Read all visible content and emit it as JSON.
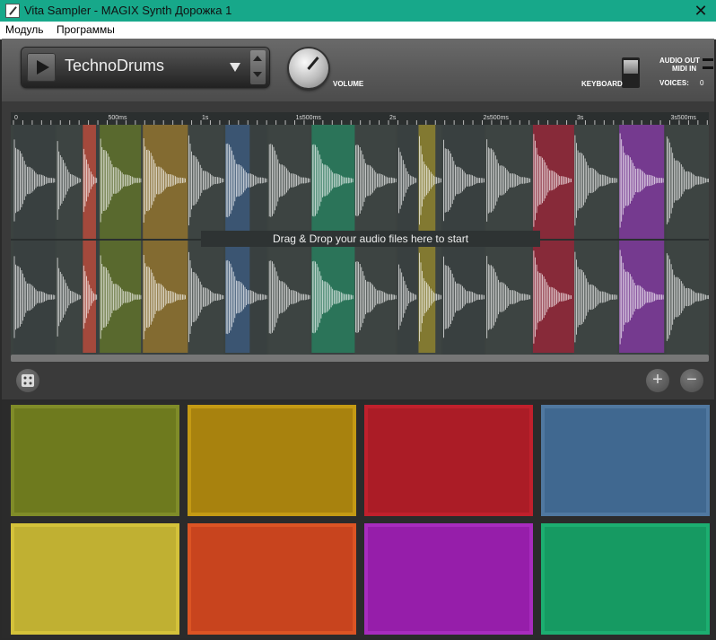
{
  "window": {
    "title": "Vita Sampler - MAGIX Synth Дорожка 1",
    "close_icon": "close-icon"
  },
  "menu": [
    "Модуль",
    "Программы"
  ],
  "instrument": {
    "preset_name": "TechnoDrums",
    "volume_label": "VOLUME",
    "keyboard_label": "KEYBOARD",
    "audio_out_label": "AUDIO OUT",
    "midi_in_label": "MIDI IN",
    "voices_label": "VOICES:",
    "voices_value": "0"
  },
  "timeline": {
    "ruler": [
      {
        "label": "0",
        "time_s": 0
      },
      {
        "label": "500ms",
        "time_s": 0.5
      },
      {
        "label": "1s",
        "time_s": 1.0
      },
      {
        "label": "1s500ms",
        "time_s": 1.5
      },
      {
        "label": "2s",
        "time_s": 2.0
      },
      {
        "label": "2s500ms",
        "time_s": 2.5
      },
      {
        "label": "3s",
        "time_s": 3.0
      },
      {
        "label": "3s500ms",
        "time_s": 3.5
      }
    ],
    "drop_message": "Drag & Drop your audio files here to start",
    "regions": [
      {
        "color": "#b04a3c",
        "start_s": 0.37,
        "end_s": 0.44
      },
      {
        "color": "#5c6e2c",
        "start_s": 0.46,
        "end_s": 0.68
      },
      {
        "color": "#8c7030",
        "start_s": 0.69,
        "end_s": 0.93
      },
      {
        "color": "#3c5878",
        "start_s": 1.13,
        "end_s": 1.26
      },
      {
        "color": "#2a7a5c",
        "start_s": 1.59,
        "end_s": 1.82
      },
      {
        "color": "#8a8030",
        "start_s": 2.16,
        "end_s": 2.25
      },
      {
        "color": "#902838",
        "start_s": 2.77,
        "end_s": 2.99
      },
      {
        "color": "#7c3a98",
        "start_s": 3.23,
        "end_s": 3.47
      }
    ],
    "hits_s": [
      0.0,
      0.23,
      0.37,
      0.46,
      0.69,
      0.93,
      1.13,
      1.36,
      1.59,
      1.82,
      2.05,
      2.16,
      2.29,
      2.52,
      2.77,
      2.99,
      3.23,
      3.48
    ]
  },
  "toolbar": {
    "dice_icon": "dice-icon",
    "zoom_in_icon": "zoom-in-icon",
    "zoom_out_icon": "zoom-out-icon"
  },
  "pads": [
    {
      "fill": "#6e7a1e",
      "border": "#808c28"
    },
    {
      "fill": "#a8820e",
      "border": "#c49a14"
    },
    {
      "fill": "#ab1c26",
      "border": "#c0202c"
    },
    {
      "fill": "#406890",
      "border": "#5078a0"
    },
    {
      "fill": "#c0b032",
      "border": "#d4c23a"
    },
    {
      "fill": "#c8441e",
      "border": "#dc5424"
    },
    {
      "fill": "#961eaa",
      "border": "#a82cbe"
    },
    {
      "fill": "#169a62",
      "border": "#1cae70"
    }
  ]
}
